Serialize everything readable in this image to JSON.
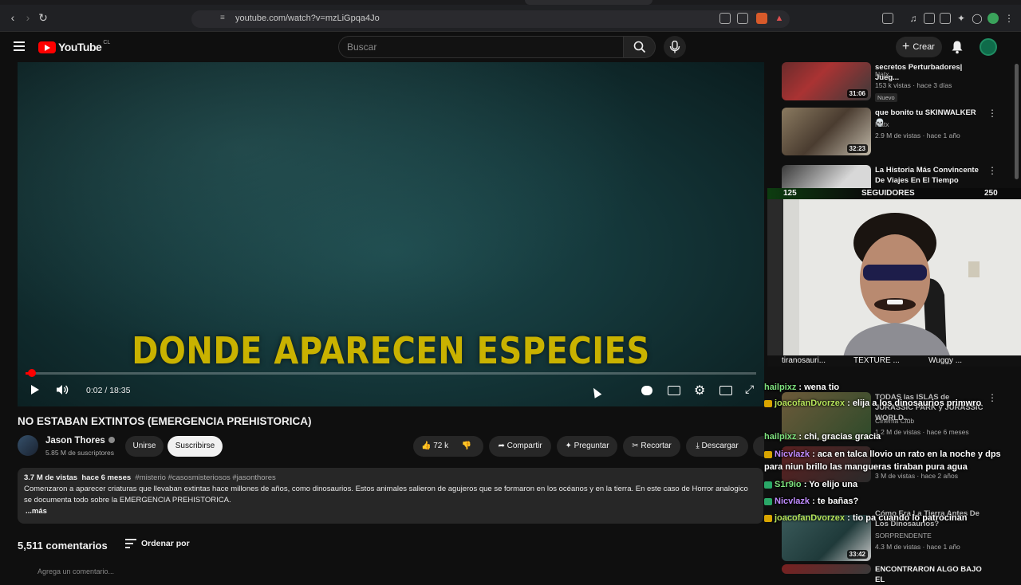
{
  "browser": {
    "url": "youtube.com/watch?v=mzLiGpqa4Jo"
  },
  "header": {
    "logo_text": "YouTube",
    "logo_region": "CL",
    "search_placeholder": "Buscar",
    "create_label": "Crear"
  },
  "video": {
    "subtitle": "DONDE APARECEN ESPECIES",
    "time": "0:02 / 18:35",
    "progress_fraction": 0.002,
    "title": "NO ESTABAN EXTINTOS (EMERGENCIA PREHISTORICA)"
  },
  "channel": {
    "name": "Jason Thores",
    "subscribers": "5.85 M de suscriptores",
    "join_label": "Unirse",
    "subscribe_label": "Suscribirse"
  },
  "actions": {
    "likes": "72 k",
    "share": "Compartir",
    "ask": "Preguntar",
    "clip": "Recortar",
    "download": "Descargar"
  },
  "description": {
    "views": "3.7 M de vistas",
    "age": "hace 6 meses",
    "tags": "#misterio #casosmisteriosos #jasonthores",
    "text": "Comenzaron a aparecer criaturas que llevaban extintas hace millones de años, como dinosaurios. Estos animales salieron de agujeros que se formaron en los océanos y en la tierra.  En este caso de Horror analogico se documenta todo sobre la EMERGENCIA PREHISTORICA.",
    "more": "...más"
  },
  "comments": {
    "count": "5,511 comentarios",
    "sort_label": "Ordenar por",
    "add_placeholder": "Agrega un comentario..."
  },
  "recommendations": [
    {
      "title": "secretos Perturbadores| Jueg...",
      "channel": "Natx",
      "meta": "153 k vistas · hace 3 días",
      "duration": "31:06",
      "badge": "Nuevo"
    },
    {
      "title": "que bonito tu SKINWALKER 💀",
      "channel": "Natx",
      "meta": "2.9 M de vistas · hace 1 año",
      "duration": "32:23"
    },
    {
      "title": "La Historia Más Convincente De Viajes En El Tiempo",
      "channel": "",
      "meta": "",
      "duration": ""
    },
    {
      "title": "TODAS las ISLAS de JURASSIC PARK y JURASSIC WORLD...",
      "channel": "Cinema Club",
      "meta": "1.2 M de vistas · hace 6 meses",
      "duration": ""
    },
    {
      "title": "Cómo Era La Tierra Antes De Los Dinosaurios?",
      "channel": "SORPRENDENTE",
      "meta": "4.3 M de vistas · hace 1 año",
      "duration": "33:42"
    },
    {
      "title": "ENCONTRARON ALGO BAJO EL",
      "channel": "",
      "meta": "",
      "duration": ""
    }
  ],
  "overlay": {
    "follow_min": "125",
    "follow_label": "SEGUIDORES",
    "follow_max": "250",
    "cam_items": [
      "tiranosauri...",
      "TEXTURE ...",
      "Wuggy ..."
    ]
  },
  "chat": [
    {
      "user": "hailpixz",
      "msg": "wena tio",
      "color": "#7ee27e"
    },
    {
      "user": "joacofanDvorzex",
      "msg": "elija a los dinosaurios primwro",
      "color": "#b5e35a"
    },
    {
      "user": "hailpixz",
      "msg": "chi, gracias gracia",
      "color": "#7ee27e"
    },
    {
      "user": "Nicvlazk",
      "msg": "aca en talca llovio un rato en la noche y dps para niun brillo las mangueras tiraban pura agua",
      "color": "#c08cff"
    },
    {
      "user": "S1r9io",
      "msg": "Yo elijo una",
      "color": "#7ee27e"
    },
    {
      "user": "Nicvlazk",
      "msg": "te bañas?",
      "color": "#c08cff"
    },
    {
      "user": "joacofanDvorzex",
      "msg": "tio pa cuando lo patrocinan",
      "color": "#b5e35a"
    }
  ],
  "colors": {
    "brand_red": "#ff0000",
    "subtitle_yellow": "#c9b200"
  }
}
